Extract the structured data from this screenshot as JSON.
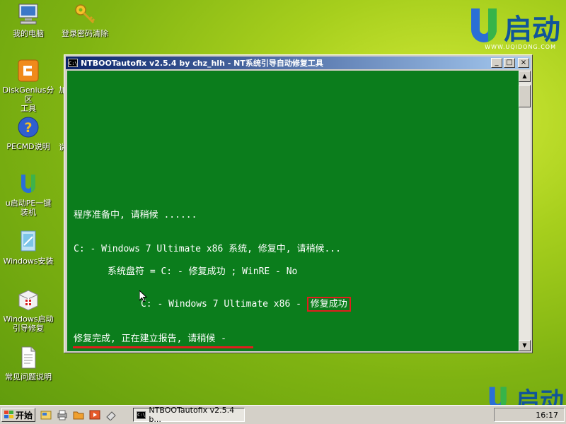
{
  "desktop": {
    "icons": [
      {
        "name": "computer",
        "label": "我的电脑"
      },
      {
        "name": "key",
        "label": "登录密码清除"
      },
      {
        "name": "diskgenius",
        "label": "DiskGenius分区\n工具"
      },
      {
        "name": "help",
        "label": "PECMD说明"
      },
      {
        "name": "uqidong",
        "label": "u启动PE一键\n装机"
      },
      {
        "name": "windows-install",
        "label": "Windows安装"
      },
      {
        "name": "repair",
        "label": "Windows启动\n引导修复"
      },
      {
        "name": "document",
        "label": "常见问题说明"
      }
    ],
    "partial_labels": [
      "加",
      "说"
    ]
  },
  "brand": {
    "name": "启动",
    "url": "WWW.UQIDONG.COM"
  },
  "window": {
    "title": "NTBOOTautofix v2.5.4 by chz_hlh - NT系统引导自动修复工具",
    "icon_text": "C:\\",
    "buttons": {
      "minimize": "_",
      "maximize": "□",
      "close": "×"
    },
    "console": {
      "line1": "程序准备中, 请稍候 ......",
      "line2": "C: - Windows 7 Ultimate x86 系统, 修复中, 请稍候...",
      "line3": "系统盘符 = C: - 修复成功 ; WinRE - No",
      "line4_prefix": "C: - Windows 7 Ultimate x86 - ",
      "line4_status": "修复成功",
      "line5": "修复完成, 正在建立报告, 请稍候 -"
    },
    "scroll": {
      "up": "▲",
      "down": "▼"
    }
  },
  "taskbar": {
    "start_label": "开始",
    "task_label": "NTBOOTautofix v2.5.4 b...",
    "clock": "16:17"
  },
  "colors": {
    "console_bg": "#0b7d1c",
    "highlight_red": "#e21d1d",
    "titlebar_start": "#0a246a",
    "titlebar_end": "#a6caf0"
  }
}
